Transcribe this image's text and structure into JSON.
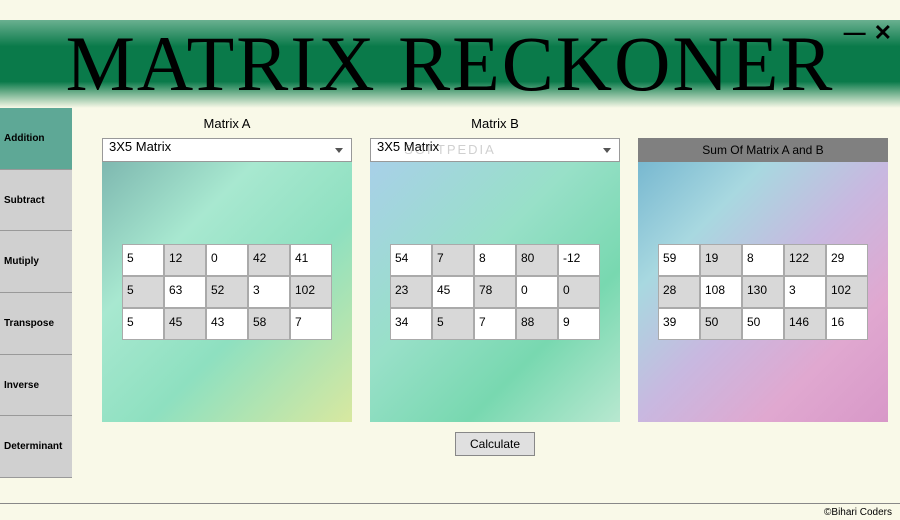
{
  "window": {
    "minimize": "—",
    "close": "✕"
  },
  "title": "MATRIX  RECKONER",
  "sidebar": {
    "items": [
      {
        "label": "Addition",
        "active": true
      },
      {
        "label": "Subtract",
        "active": false
      },
      {
        "label": "Mutiply",
        "active": false
      },
      {
        "label": "Transpose",
        "active": false
      },
      {
        "label": "Inverse",
        "active": false
      },
      {
        "label": "Determinant",
        "active": false
      }
    ]
  },
  "panels": {
    "a": {
      "label": "Matrix A",
      "select": "3X5  Matrix",
      "cells": [
        [
          "5",
          "12",
          "0",
          "42",
          "41"
        ],
        [
          "5",
          "63",
          "52",
          "3",
          "102"
        ],
        [
          "5",
          "45",
          "43",
          "58",
          "7"
        ]
      ]
    },
    "b": {
      "label": "Matrix B",
      "select": "3X5  Matrix",
      "cells": [
        [
          "54",
          "7",
          "8",
          "80",
          "-12"
        ],
        [
          "23",
          "45",
          "78",
          "0",
          "0"
        ],
        [
          "34",
          "5",
          "7",
          "88",
          "9"
        ]
      ]
    },
    "c": {
      "header": "Sum Of Matrix A and B",
      "cells": [
        [
          "59",
          "19",
          "8",
          "122",
          "29"
        ],
        [
          "28",
          "108",
          "130",
          "3",
          "102"
        ],
        [
          "39",
          "50",
          "50",
          "146",
          "16"
        ]
      ]
    }
  },
  "calculate": "Calculate",
  "footer": "©Bihari Coders",
  "watermark": "SOFTPEDIA"
}
